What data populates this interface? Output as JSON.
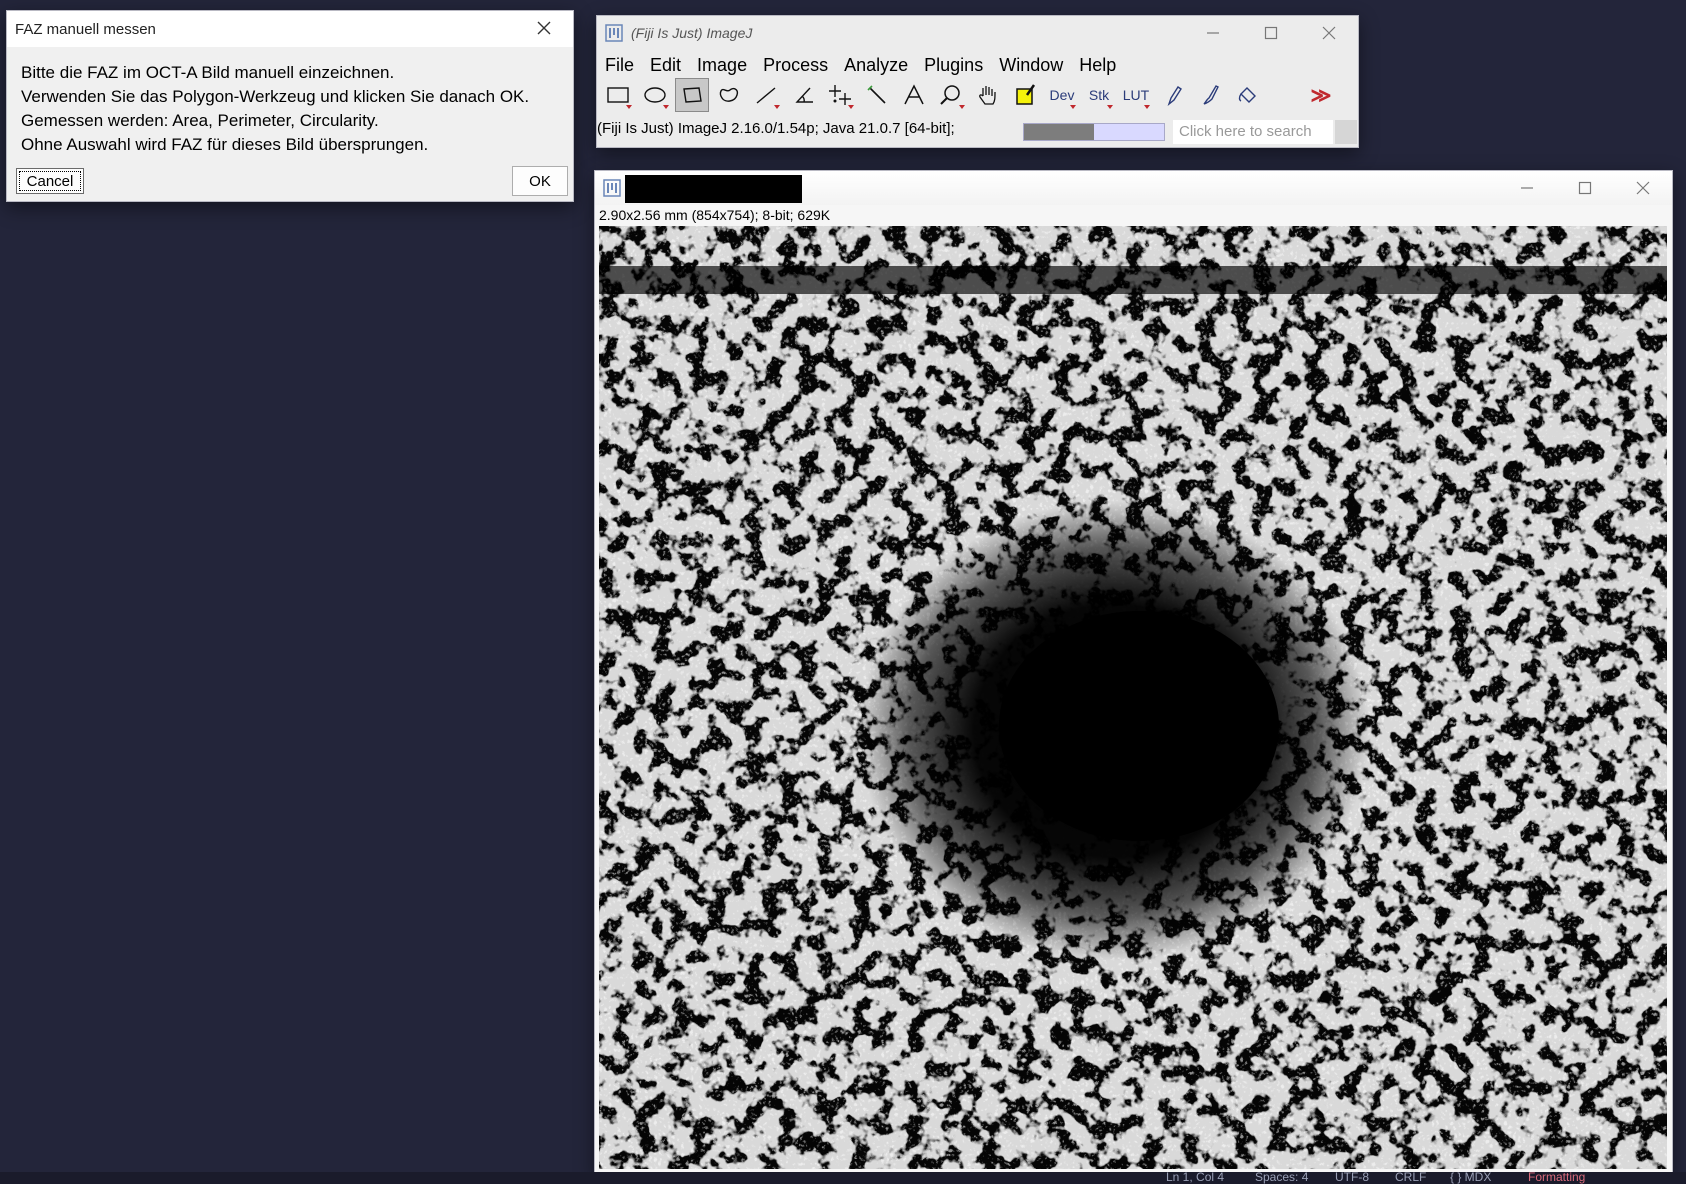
{
  "dialog": {
    "title": "FAZ manuell messen",
    "lines": [
      "Bitte die FAZ im OCT-A Bild manuell einzeichnen.",
      "Verwenden Sie das Polygon-Werkzeug und klicken Sie danach OK.",
      "Gemessen werden: Area, Perimeter, Circularity.",
      "Ohne Auswahl wird FAZ für dieses Bild übersprungen."
    ],
    "cancel_label": "Cancel",
    "ok_label": "OK"
  },
  "imagej": {
    "title": "(Fiji Is Just) ImageJ",
    "menu": [
      "File",
      "Edit",
      "Image",
      "Process",
      "Analyze",
      "Plugins",
      "Window",
      "Help"
    ],
    "tools": [
      {
        "icon": "rectangle-tool-icon"
      },
      {
        "icon": "oval-tool-icon"
      },
      {
        "icon": "polygon-tool-icon",
        "active": true
      },
      {
        "icon": "freehand-tool-icon"
      },
      {
        "icon": "line-tool-icon"
      },
      {
        "icon": "angle-tool-icon"
      },
      {
        "icon": "point-tool-icon"
      },
      {
        "icon": "wand-tool-icon"
      },
      {
        "icon": "text-tool-icon"
      },
      {
        "icon": "magnifier-tool-icon"
      },
      {
        "icon": "hand-tool-icon"
      },
      {
        "icon": "color-picker-tool-icon"
      },
      {
        "label": "Dev"
      },
      {
        "label": "Stk"
      },
      {
        "label": "LUT"
      },
      {
        "icon": "pencil-tool-icon"
      },
      {
        "icon": "brush-tool-icon"
      },
      {
        "icon": "flood-fill-tool-icon"
      },
      {
        "icon": "empty-slot"
      },
      {
        "icon": "more-tools-icon",
        "label": "≫"
      }
    ],
    "status": "(Fiji Is Just) ImageJ 2.16.0/1.54p; Java 21.0.7 [64-bit];",
    "progress_fraction": 0.5,
    "search_placeholder": "Click here to search"
  },
  "image_window": {
    "info": "2.90x2.56 mm (854x754); 8-bit; 629K"
  },
  "editor_status": {
    "items": [
      "Ln 1, Col 4",
      "Spaces: 4",
      "UTF-8",
      "CRLF",
      "{ } MDX",
      "Formatting"
    ]
  },
  "colors": {
    "accent_red": "#c0282d",
    "progress_fill": "#7d7d7d",
    "progress_track": "#d9d9ff",
    "desktop": "#23253a"
  }
}
